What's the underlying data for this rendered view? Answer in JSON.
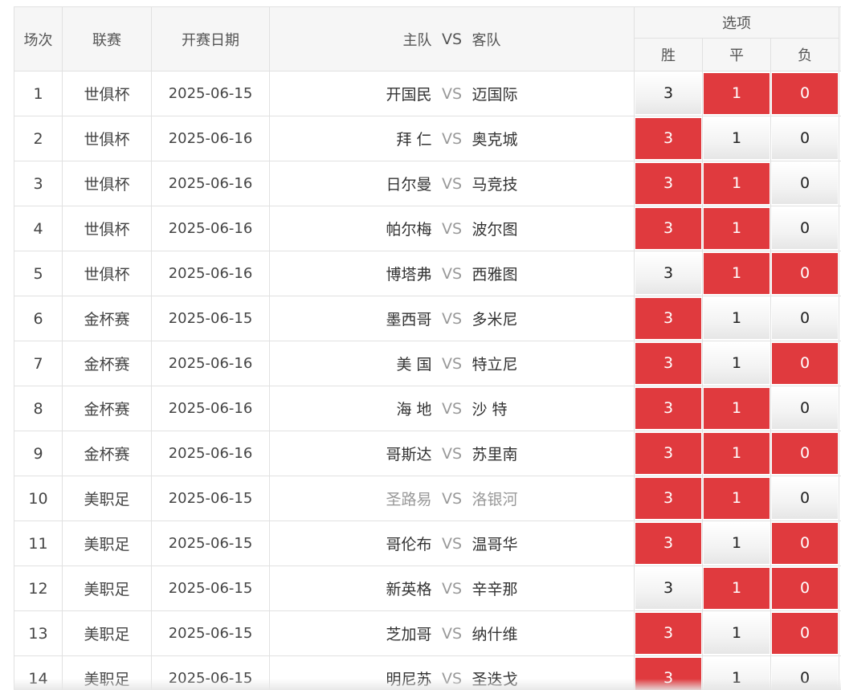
{
  "header": {
    "col_num": "场次",
    "col_league": "联赛",
    "col_date": "开赛日期",
    "col_home": "主队",
    "col_vs": "VS",
    "col_away": "客队",
    "col_options": "选项",
    "opt_win": "胜",
    "opt_draw": "平",
    "opt_loss": "负"
  },
  "colors": {
    "selected": "#e03a3e",
    "border": "#e1e1e1",
    "header_bg": "#f6f6f6"
  },
  "matches": [
    {
      "num": "1",
      "league": "世俱杯",
      "date": "2025-06-15",
      "home": "开国民",
      "vs": "VS",
      "away": "迈国际",
      "win": "3",
      "draw": "1",
      "loss": "0",
      "selected": [
        false,
        true,
        true
      ],
      "muted": false
    },
    {
      "num": "2",
      "league": "世俱杯",
      "date": "2025-06-16",
      "home": "拜 仁",
      "vs": "VS",
      "away": "奥克城",
      "win": "3",
      "draw": "1",
      "loss": "0",
      "selected": [
        true,
        false,
        false
      ],
      "muted": false
    },
    {
      "num": "3",
      "league": "世俱杯",
      "date": "2025-06-16",
      "home": "日尔曼",
      "vs": "VS",
      "away": "马竞技",
      "win": "3",
      "draw": "1",
      "loss": "0",
      "selected": [
        true,
        true,
        false
      ],
      "muted": false
    },
    {
      "num": "4",
      "league": "世俱杯",
      "date": "2025-06-16",
      "home": "帕尔梅",
      "vs": "VS",
      "away": "波尔图",
      "win": "3",
      "draw": "1",
      "loss": "0",
      "selected": [
        true,
        true,
        false
      ],
      "muted": false
    },
    {
      "num": "5",
      "league": "世俱杯",
      "date": "2025-06-16",
      "home": "博塔弗",
      "vs": "VS",
      "away": "西雅图",
      "win": "3",
      "draw": "1",
      "loss": "0",
      "selected": [
        false,
        true,
        true
      ],
      "muted": false
    },
    {
      "num": "6",
      "league": "金杯赛",
      "date": "2025-06-15",
      "home": "墨西哥",
      "vs": "VS",
      "away": "多米尼",
      "win": "3",
      "draw": "1",
      "loss": "0",
      "selected": [
        true,
        false,
        false
      ],
      "muted": false
    },
    {
      "num": "7",
      "league": "金杯赛",
      "date": "2025-06-16",
      "home": "美 国",
      "vs": "VS",
      "away": "特立尼",
      "win": "3",
      "draw": "1",
      "loss": "0",
      "selected": [
        true,
        false,
        true
      ],
      "muted": false
    },
    {
      "num": "8",
      "league": "金杯赛",
      "date": "2025-06-16",
      "home": "海 地",
      "vs": "VS",
      "away": "沙 特",
      "win": "3",
      "draw": "1",
      "loss": "0",
      "selected": [
        true,
        true,
        false
      ],
      "muted": false
    },
    {
      "num": "9",
      "league": "金杯赛",
      "date": "2025-06-16",
      "home": "哥斯达",
      "vs": "VS",
      "away": "苏里南",
      "win": "3",
      "draw": "1",
      "loss": "0",
      "selected": [
        true,
        true,
        true
      ],
      "muted": false
    },
    {
      "num": "10",
      "league": "美职足",
      "date": "2025-06-15",
      "home": "圣路易",
      "vs": "VS",
      "away": "洛银河",
      "win": "3",
      "draw": "1",
      "loss": "0",
      "selected": [
        true,
        true,
        false
      ],
      "muted": true
    },
    {
      "num": "11",
      "league": "美职足",
      "date": "2025-06-15",
      "home": "哥伦布",
      "vs": "VS",
      "away": "温哥华",
      "win": "3",
      "draw": "1",
      "loss": "0",
      "selected": [
        true,
        false,
        true
      ],
      "muted": false
    },
    {
      "num": "12",
      "league": "美职足",
      "date": "2025-06-15",
      "home": "新英格",
      "vs": "VS",
      "away": "辛辛那",
      "win": "3",
      "draw": "1",
      "loss": "0",
      "selected": [
        false,
        true,
        true
      ],
      "muted": false
    },
    {
      "num": "13",
      "league": "美职足",
      "date": "2025-06-15",
      "home": "芝加哥",
      "vs": "VS",
      "away": "纳什维",
      "win": "3",
      "draw": "1",
      "loss": "0",
      "selected": [
        true,
        false,
        true
      ],
      "muted": false
    },
    {
      "num": "14",
      "league": "美职足",
      "date": "2025-06-15",
      "home": "明尼苏",
      "vs": "VS",
      "away": "圣迭戈",
      "win": "3",
      "draw": "1",
      "loss": "0",
      "selected": [
        true,
        false,
        false
      ],
      "muted": false
    }
  ]
}
